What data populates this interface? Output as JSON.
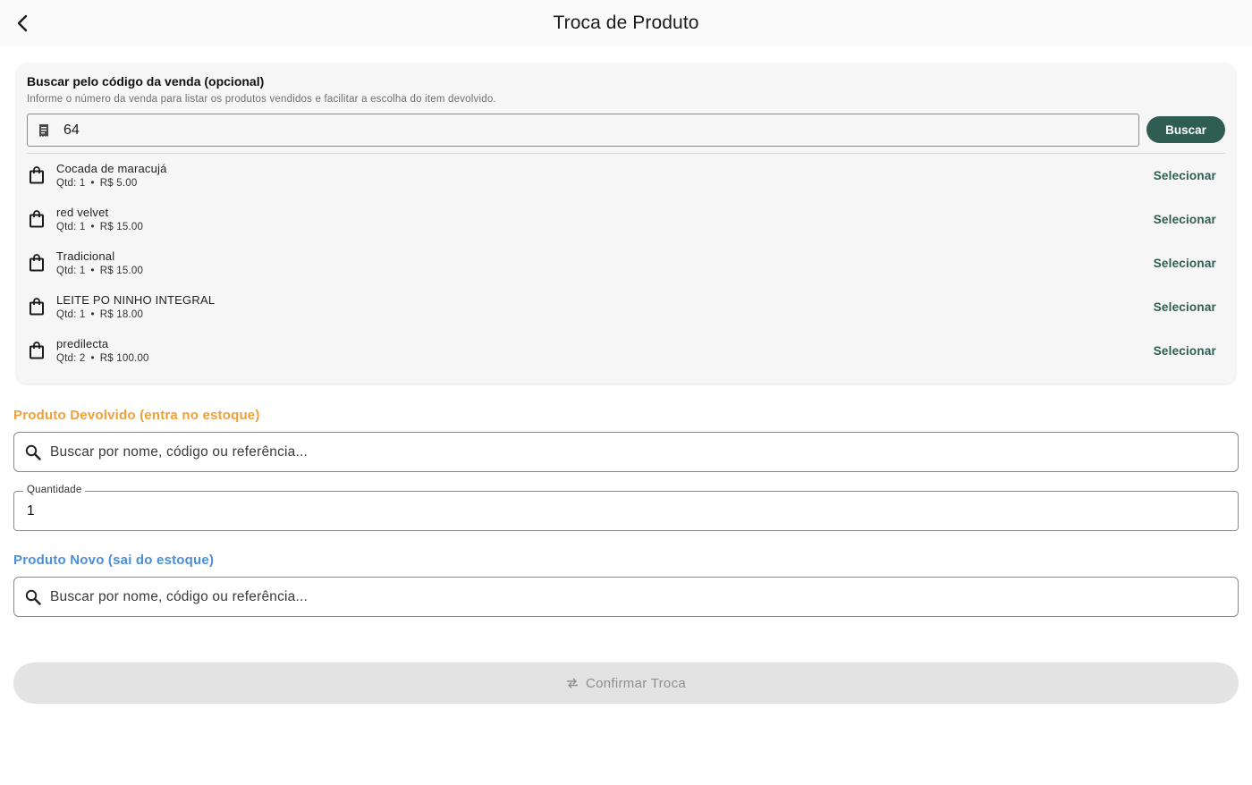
{
  "appbar": {
    "title": "Troca de Produto"
  },
  "sale_search": {
    "title": "Buscar pelo código da venda (opcional)",
    "subtitle": "Informe o número da venda para listar os produtos vendidos e facilitar a escolha do item devolvido.",
    "value": "64",
    "button_label": "Buscar"
  },
  "sale_items": [
    {
      "name": "Cocada de maracujá",
      "qty": "Qtd: 1",
      "price": "R$ 5.00",
      "action": "Selecionar"
    },
    {
      "name": "red velvet",
      "qty": "Qtd: 1",
      "price": "R$ 15.00",
      "action": "Selecionar"
    },
    {
      "name": "Tradicional",
      "qty": "Qtd: 1",
      "price": "R$ 15.00",
      "action": "Selecionar"
    },
    {
      "name": "LEITE PO NINHO INTEGRAL",
      "qty": "Qtd: 1",
      "price": "R$ 18.00",
      "action": "Selecionar"
    },
    {
      "name": "predilecta",
      "qty": "Qtd: 2",
      "price": "R$ 100.00",
      "action": "Selecionar"
    }
  ],
  "returned": {
    "label": "Produto Devolvido (entra no estoque)",
    "placeholder": "Buscar por nome, código ou referência...",
    "color": "#f0a03a"
  },
  "quantity": {
    "label": "Quantidade",
    "value": "1"
  },
  "new_product": {
    "label": "Produto Novo (sai do estoque)",
    "placeholder": "Buscar por nome, código ou referência...",
    "color": "#4a8fd8"
  },
  "confirm": {
    "label": "Confirmar Troca"
  },
  "colors": {
    "primary": "#2f5d52",
    "disabled_bg": "#e3e3e3",
    "disabled_text": "#8e8e8e"
  },
  "icons": {
    "back": "chevron-left-icon",
    "receipt": "receipt-icon",
    "bag": "shopping-bag-icon",
    "search": "search-icon",
    "swap": "swap-icon"
  }
}
